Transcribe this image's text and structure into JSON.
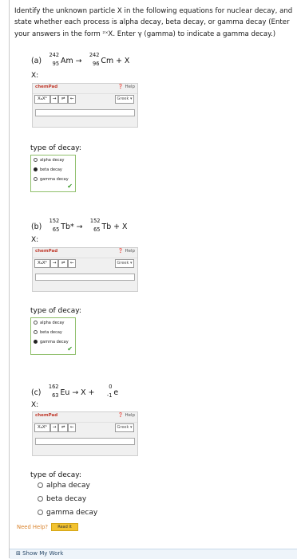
{
  "instructions": "Identify the unknown particle X in the following equations for nuclear decay, and state whether each process is alpha decay, beta decay, or gamma decay (Enter your answers in the form ᶻˣX. Enter γ (gamma) to indicate a gamma decay.)",
  "chempad": {
    "title": "chemPad",
    "help": "Help",
    "greek": "Greek",
    "buttons": [
      "XₐXᵇ",
      "→",
      "⇌",
      "←"
    ]
  },
  "x_label": "X:",
  "type_label": "type of decay:",
  "decay_options": [
    "alpha decay",
    "beta decay",
    "gamma decay"
  ],
  "parts": [
    {
      "label": "(a)",
      "reactant": {
        "mass": "242",
        "atomic": "95",
        "symbol": "Am"
      },
      "arrow": "→",
      "product": {
        "mass": "242",
        "atomic": "96",
        "symbol": "Cm"
      },
      "plus": "+ X",
      "selected": "beta decay"
    },
    {
      "label": "(b)",
      "reactant": {
        "mass": "152",
        "atomic": "65",
        "symbol": "Tb*"
      },
      "arrow": "→",
      "product": {
        "mass": "152",
        "atomic": "65",
        "symbol": "Tb"
      },
      "plus": "+ X",
      "selected": "gamma decay"
    },
    {
      "label": "(c)",
      "reactant": {
        "mass": "162",
        "atomic": "63",
        "symbol": "Eu"
      },
      "arrow": "→ X +",
      "product": {
        "mass": "0",
        "atomic": "-1",
        "symbol": "e"
      },
      "plus": "",
      "selected": ""
    }
  ],
  "need_help": "Need Help?",
  "read_it": "Read It",
  "bottom_link": "Show My Work"
}
